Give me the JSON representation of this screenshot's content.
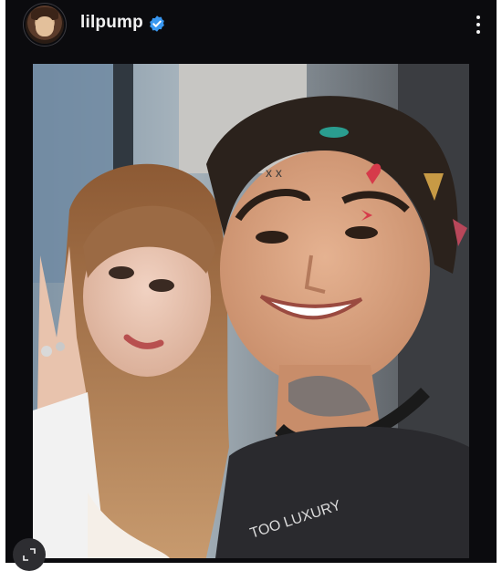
{
  "post": {
    "username": "lilpump",
    "verified": true,
    "more_icon": "more-vertical-icon",
    "expand_icon": "expand-icon",
    "avatar_icon": "profile-avatar"
  },
  "colors": {
    "background": "#0b0b0e",
    "verified_blue": "#3897f0",
    "text": "#f2f2f2"
  }
}
